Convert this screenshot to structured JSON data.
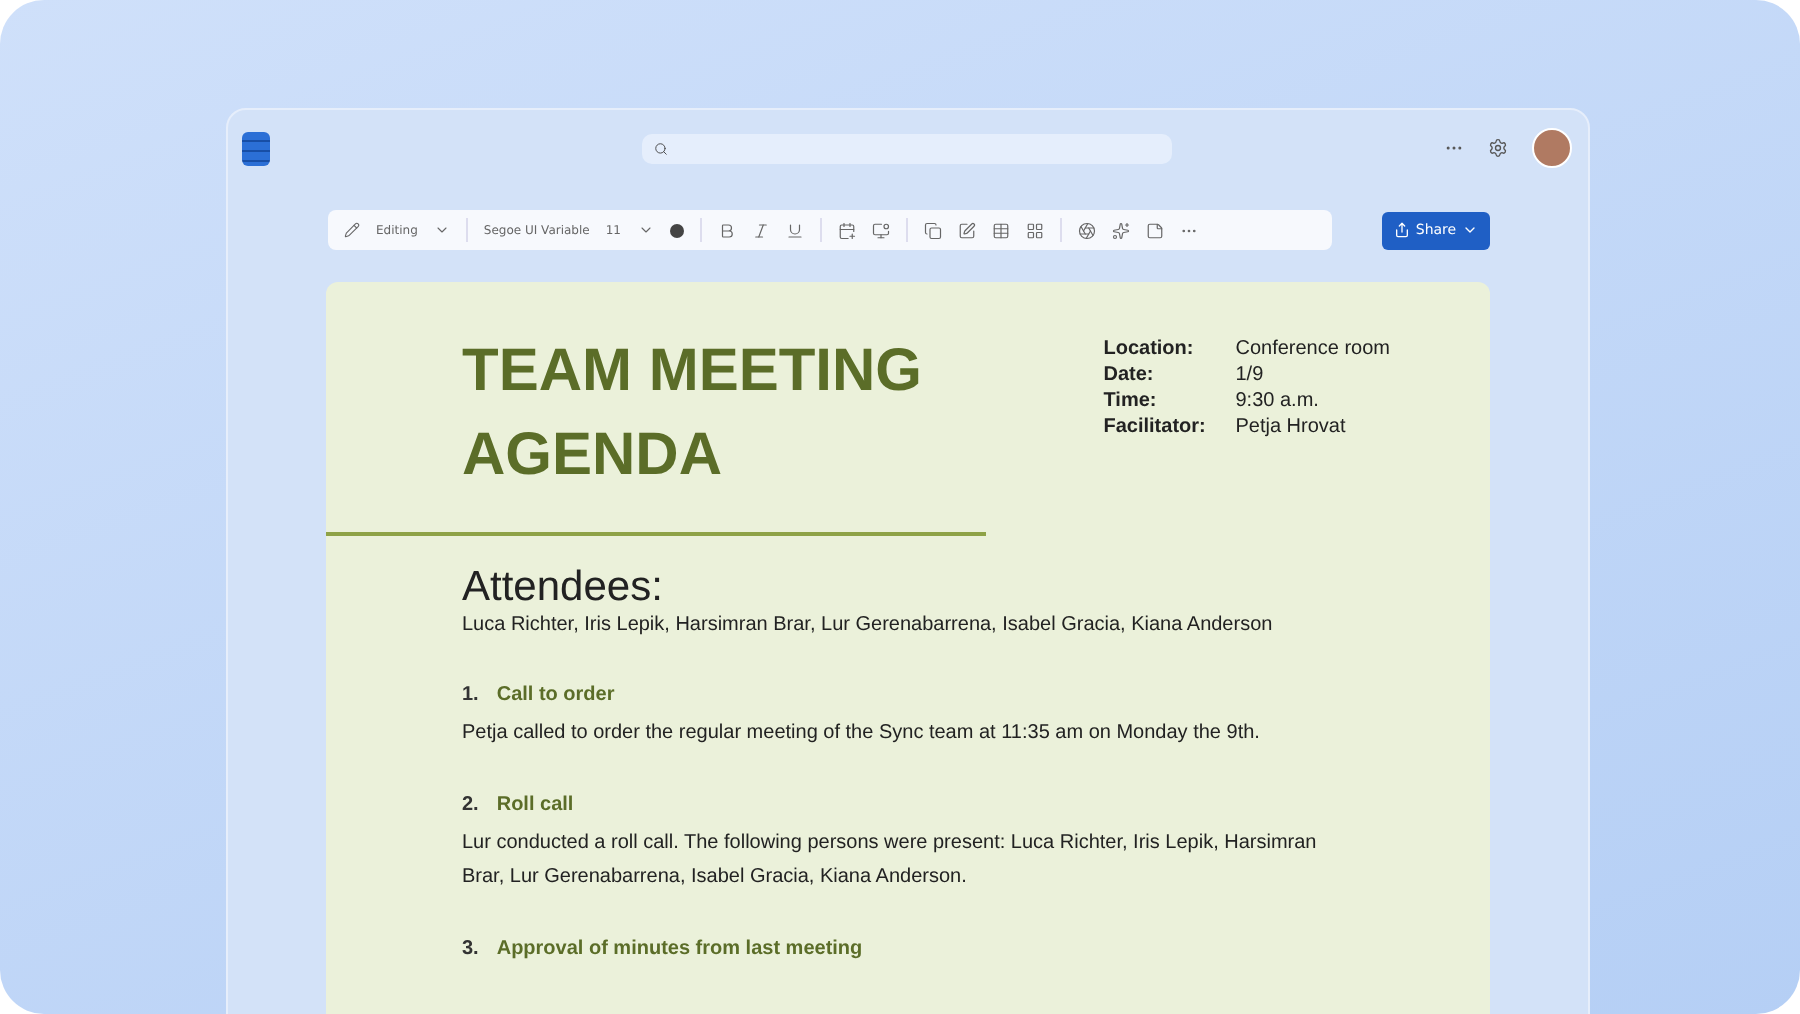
{
  "toolbar": {
    "mode": "Editing",
    "font": "Segoe UI Variable",
    "font_size": "11"
  },
  "share_button": "Share",
  "document": {
    "title": "TEAM MEETING AGENDA",
    "details": [
      {
        "label": "Location:",
        "value": "Conference room"
      },
      {
        "label": "Date:",
        "value": "1/9"
      },
      {
        "label": "Time:",
        "value": "9:30 a.m."
      },
      {
        "label": "Facilitator:",
        "value": "Petja Hrovat"
      }
    ],
    "attendees_heading": "Attendees:",
    "attendees": "Luca Richter, Iris Lepik, Harsimran Brar, Lur Gerenabarrena, Isabel Gracia, Kiana Anderson",
    "sections": [
      {
        "number": "1.",
        "title": "Call to order",
        "body": "Petja called to order the regular meeting of the Sync team at 11:35 am on Monday the 9th."
      },
      {
        "number": "2.",
        "title": "Roll call",
        "body": "Lur conducted  a roll call. The following persons were present: Luca Richter, Iris Lepik, Harsimran Brar, Lur Gerenabarrena, Isabel Gracia, Kiana Anderson."
      },
      {
        "number": "3.",
        "title": "Approval of minutes from last meeting"
      }
    ]
  }
}
